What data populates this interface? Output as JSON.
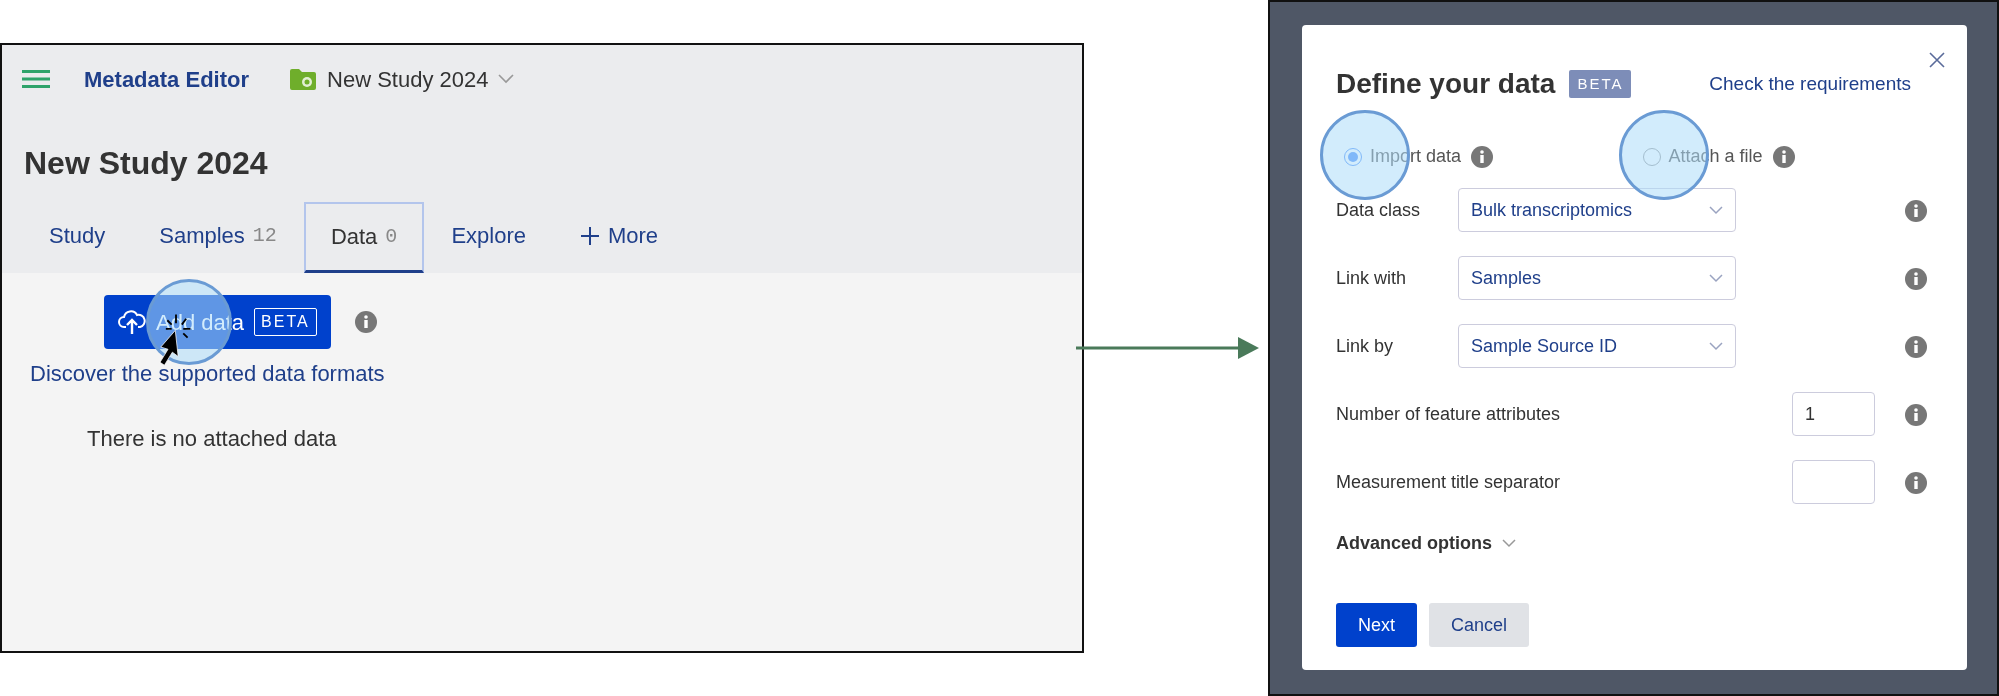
{
  "app": {
    "title": "Metadata Editor",
    "project": "New Study 2024"
  },
  "page": {
    "heading": "New Study 2024",
    "tabs": [
      {
        "kind": "tab",
        "label": "Study",
        "selected": false
      },
      {
        "kind": "tab",
        "label": "Samples",
        "count": "12",
        "selected": false
      },
      {
        "kind": "tab",
        "label": "Data",
        "count": "0",
        "selected": true
      },
      {
        "kind": "tab",
        "label": "Explore",
        "selected": false
      },
      {
        "kind": "more",
        "label": "More",
        "selected": false
      }
    ],
    "add_button": {
      "label": "Add data",
      "badge": "BETA",
      "highlighted": true
    },
    "link": "Discover the supported data formats",
    "empty_message": "There is no attached data"
  },
  "dialog": {
    "title": "Define your data",
    "badge": "BETA",
    "link": "Check the requirements",
    "options": [
      {
        "label": "Import data",
        "selected": true,
        "highlighted": true
      },
      {
        "label": "Attach a file",
        "selected": false,
        "highlighted": true
      }
    ],
    "fields": [
      {
        "kind": "select",
        "label": "Data class",
        "value": "Bulk transcriptomics"
      },
      {
        "kind": "select",
        "label": "Link with",
        "value": "Samples"
      },
      {
        "kind": "select",
        "label": "Link by",
        "value": "Sample Source ID"
      },
      {
        "kind": "number",
        "label": "Number of feature attributes",
        "value": "1"
      },
      {
        "kind": "text",
        "label": "Measurement title separator"
      }
    ],
    "advanced": {
      "label": "Advanced options",
      "expanded": false
    },
    "buttons": [
      {
        "kind": "primary",
        "label": "Next"
      },
      {
        "kind": "secondary",
        "label": "Cancel"
      }
    ]
  }
}
